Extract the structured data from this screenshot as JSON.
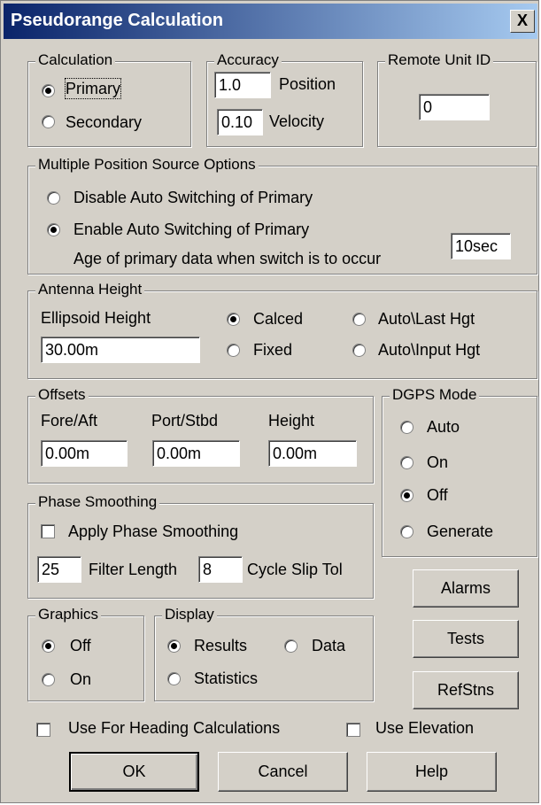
{
  "title": "Pseudorange Calculation",
  "close_glyph": "X",
  "calculation": {
    "group_label": "Calculation",
    "primary": "Primary",
    "secondary": "Secondary",
    "selected": "Primary"
  },
  "accuracy": {
    "group_label": "Accuracy",
    "position_value": "1.0",
    "position_label": "Position",
    "velocity_value": "0.10",
    "velocity_label": "Velocity"
  },
  "remote_unit": {
    "group_label": "Remote Unit ID",
    "value": "0"
  },
  "multiple_position": {
    "group_label": "Multiple Position Source Options",
    "disable_label": "Disable Auto Switching of Primary",
    "enable_label": "Enable Auto Switching of Primary",
    "age_label": "Age of primary data when switch is to occur",
    "age_value": "10sec",
    "selected": "Enable Auto Switching of Primary"
  },
  "antenna": {
    "group_label": "Antenna Height",
    "ellipsoid_label": "Ellipsoid Height",
    "ellipsoid_value": "30.00m",
    "calced": "Calced",
    "fixed": "Fixed",
    "auto_last": "Auto\\Last Hgt",
    "auto_input": "Auto\\Input Hgt",
    "selected": "Calced"
  },
  "offsets": {
    "group_label": "Offsets",
    "fore_aft_label": "Fore/Aft",
    "fore_aft_value": "0.00m",
    "port_stbd_label": "Port/Stbd",
    "port_stbd_value": "0.00m",
    "height_label": "Height",
    "height_value": "0.00m"
  },
  "dgps": {
    "group_label": "DGPS Mode",
    "auto": "Auto",
    "on": "On",
    "off": "Off",
    "generate": "Generate",
    "selected": "Off"
  },
  "phase": {
    "group_label": "Phase Smoothing",
    "apply_label": "Apply Phase Smoothing",
    "apply_checked": false,
    "filter_value": "25",
    "filter_label": "Filter Length",
    "cycle_value": "8",
    "cycle_label": "Cycle Slip Tol"
  },
  "graphics": {
    "group_label": "Graphics",
    "off": "Off",
    "on": "On",
    "selected": "Off"
  },
  "display": {
    "group_label": "Display",
    "results": "Results",
    "data": "Data",
    "statistics": "Statistics",
    "selected": "Results"
  },
  "side_buttons": {
    "alarms": "Alarms",
    "tests": "Tests",
    "refstns": "RefStns"
  },
  "checks": {
    "heading_label": "Use For Heading Calculations",
    "heading_checked": false,
    "elevation_label": "Use Elevation",
    "elevation_checked": false
  },
  "footer": {
    "ok": "OK",
    "cancel": "Cancel",
    "help": "Help"
  }
}
